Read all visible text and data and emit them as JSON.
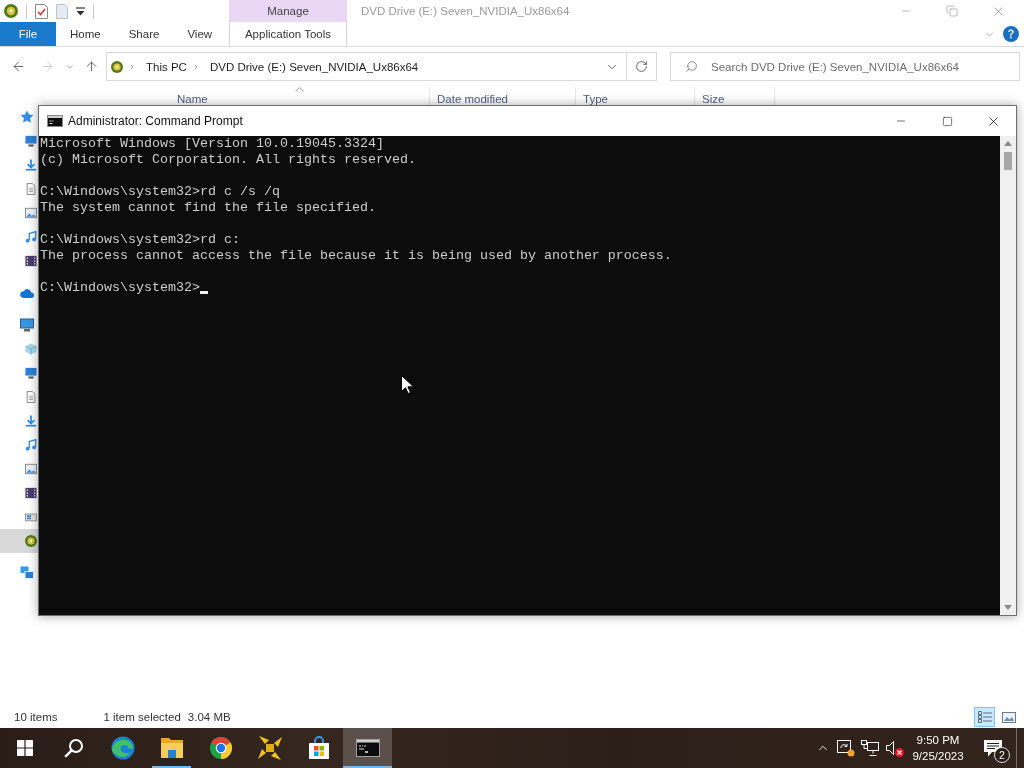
{
  "explorer": {
    "context_tab_header": "Manage",
    "title": "DVD Drive (E:) Seven_NVIDIA_Ux86x64",
    "ribbon_tabs": [
      {
        "label": "File",
        "kind": "file",
        "selected": false
      },
      {
        "label": "Home",
        "kind": "standard",
        "selected": false
      },
      {
        "label": "Share",
        "kind": "standard",
        "selected": false
      },
      {
        "label": "View",
        "kind": "standard",
        "selected": false
      },
      {
        "label": "Application Tools",
        "kind": "contextual",
        "selected": false
      }
    ],
    "address_bar": {
      "breadcrumbs": [
        "This PC",
        "DVD Drive (E:) Seven_NVIDIA_Ux86x64"
      ]
    },
    "search": {
      "placeholder": "Search DVD Drive (E:) Seven_NVIDIA_Ux86x64"
    },
    "nav_pane": {
      "items": [
        {
          "kind": "quickaccess",
          "selected": false,
          "children": [
            {
              "kind": "desktop",
              "selected": false
            },
            {
              "kind": "downloads",
              "selected": false
            },
            {
              "kind": "documents",
              "selected": false
            },
            {
              "kind": "pictures",
              "selected": false
            },
            {
              "kind": "music",
              "selected": false
            },
            {
              "kind": "videos",
              "selected": false
            }
          ]
        },
        {
          "kind": "onedrive",
          "selected": false
        },
        {
          "kind": "computer",
          "selected": false,
          "children": [
            {
              "kind": "objects",
              "selected": false
            },
            {
              "kind": "desktop",
              "selected": false
            },
            {
              "kind": "documents",
              "selected": false
            },
            {
              "kind": "downloads",
              "selected": false
            },
            {
              "kind": "music",
              "selected": false
            },
            {
              "kind": "pictures",
              "selected": false
            },
            {
              "kind": "videos",
              "selected": false
            },
            {
              "kind": "systemdrive",
              "selected": false
            },
            {
              "kind": "dvd",
              "selected": true
            }
          ]
        },
        {
          "kind": "network",
          "selected": false
        }
      ]
    },
    "columns": [
      {
        "label": "Name",
        "sorted": true
      },
      {
        "label": "Date modified",
        "sorted": false
      },
      {
        "label": "Type",
        "sorted": false
      },
      {
        "label": "Size",
        "sorted": false
      }
    ],
    "status_bar": {
      "item_count": "10 items",
      "selection": "1 item selected",
      "selection_size": "3.04 MB",
      "views": [
        {
          "kind": "details",
          "selected": true
        },
        {
          "kind": "icons",
          "selected": false
        }
      ]
    }
  },
  "command_prompt": {
    "title": "Administrator: Command Prompt",
    "blocks": [
      [
        "Microsoft Windows [Version 10.0.19045.3324]",
        "(c) Microsoft Corporation. All rights reserved."
      ],
      [
        "C:\\Windows\\system32>rd c /s /q",
        "The system cannot find the file specified."
      ],
      [
        "C:\\Windows\\system32>rd c:",
        "The process cannot access the file because it is being used by another process."
      ],
      [
        "C:\\Windows\\system32>"
      ]
    ]
  },
  "taskbar": {
    "buttons": [
      {
        "kind": "start",
        "running": false,
        "active": false
      },
      {
        "kind": "search",
        "running": false,
        "active": false
      },
      {
        "kind": "edge",
        "running": false,
        "active": false
      },
      {
        "kind": "explorer",
        "running": true,
        "active": false
      },
      {
        "kind": "chrome",
        "running": false,
        "active": false
      },
      {
        "kind": "pinwheel",
        "running": false,
        "active": false
      },
      {
        "kind": "store",
        "running": false,
        "active": false
      },
      {
        "kind": "terminal",
        "running": true,
        "active": true
      }
    ],
    "volume": {
      "muted": true
    },
    "clock": {
      "time": "9:50 PM",
      "date": "9/25/2023"
    },
    "notifications": {
      "count": "2"
    }
  }
}
